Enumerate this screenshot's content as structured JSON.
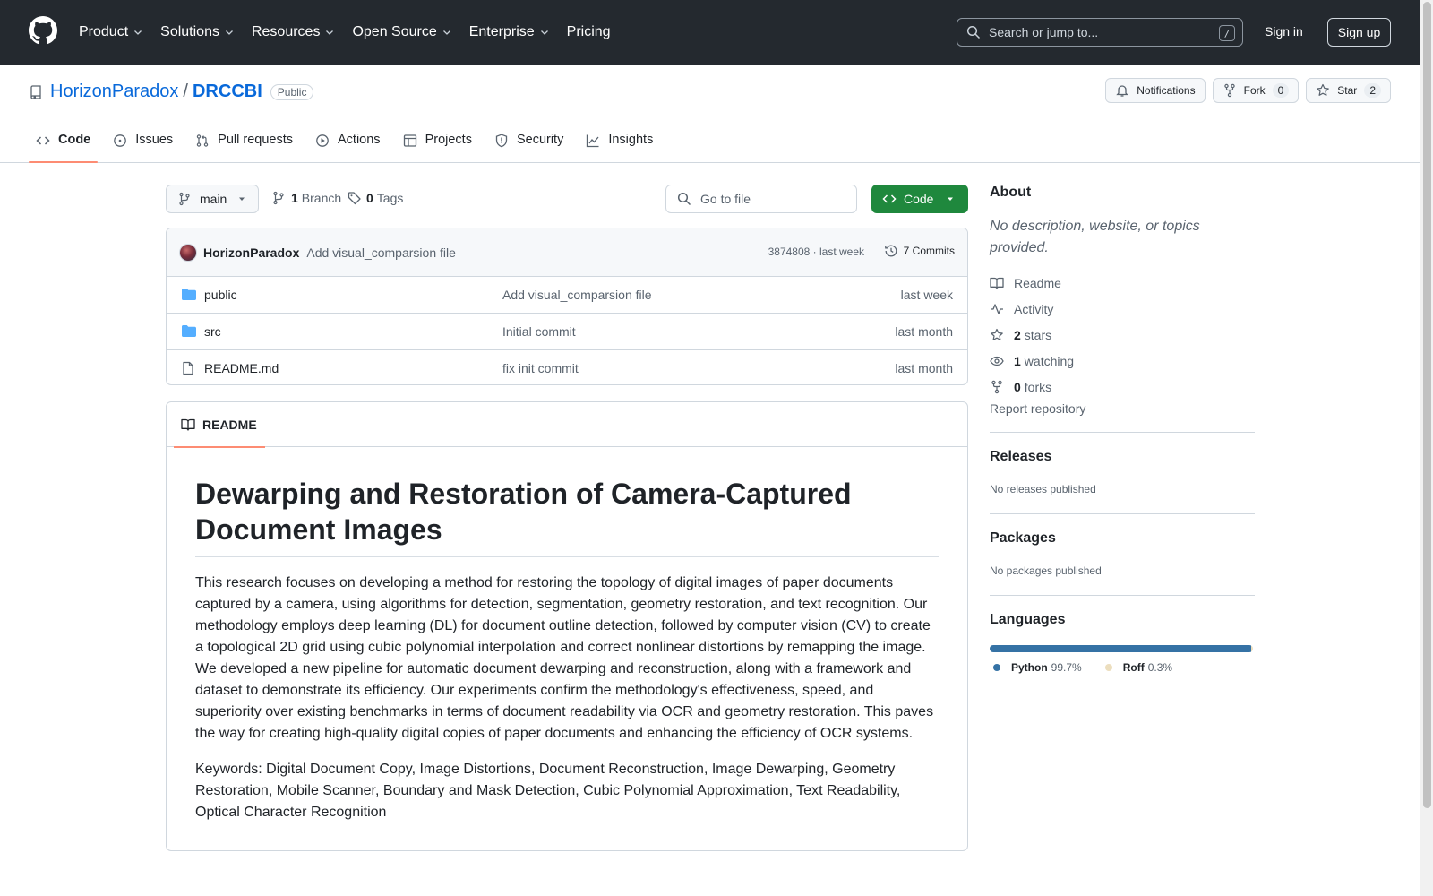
{
  "header": {
    "nav": [
      {
        "label": "Product",
        "has_menu": true
      },
      {
        "label": "Solutions",
        "has_menu": true
      },
      {
        "label": "Resources",
        "has_menu": true
      },
      {
        "label": "Open Source",
        "has_menu": true
      },
      {
        "label": "Enterprise",
        "has_menu": true
      },
      {
        "label": "Pricing",
        "has_menu": false
      }
    ],
    "search_placeholder": "Search or jump to...",
    "search_shortcut": "/",
    "sign_in": "Sign in",
    "sign_up": "Sign up"
  },
  "repo": {
    "owner": "HorizonParadox",
    "separator": "/",
    "name": "DRCCBI",
    "visibility": "Public",
    "notifications_label": "Notifications",
    "fork_label": "Fork",
    "fork_count": "0",
    "star_label": "Star",
    "star_count": "2"
  },
  "tabs": [
    {
      "label": "Code",
      "icon": "code-icon",
      "active": true
    },
    {
      "label": "Issues",
      "icon": "issue-icon",
      "active": false
    },
    {
      "label": "Pull requests",
      "icon": "pull-request-icon",
      "active": false
    },
    {
      "label": "Actions",
      "icon": "play-icon",
      "active": false
    },
    {
      "label": "Projects",
      "icon": "table-icon",
      "active": false
    },
    {
      "label": "Security",
      "icon": "shield-icon",
      "active": false
    },
    {
      "label": "Insights",
      "icon": "graph-icon",
      "active": false
    }
  ],
  "toolbar": {
    "branch": "main",
    "branch_count": "1",
    "branch_label": "Branch",
    "tag_count": "0",
    "tag_label": "Tags",
    "goto_placeholder": "Go to file",
    "code_button": "Code"
  },
  "latest_commit": {
    "author": "HorizonParadox",
    "message": "Add visual_comparsion file",
    "meta": "3874808 · last week",
    "commits_label": "7 Commits"
  },
  "files": [
    {
      "name": "public",
      "type": "folder",
      "message": "Add visual_comparsion file",
      "date": "last week"
    },
    {
      "name": "src",
      "type": "folder",
      "message": "Initial commit",
      "date": "last month"
    },
    {
      "name": "README.md",
      "type": "file",
      "message": "fix init commit",
      "date": "last month"
    }
  ],
  "readme": {
    "tab_label": "README",
    "title": "Dewarping and Restoration of Camera-Captured Document Images",
    "paragraph": "This research focuses on developing a method for restoring the topology of digital images of paper documents captured by a camera, using algorithms for detection, segmentation, geometry restoration, and text recognition. Our methodology employs deep learning (DL) for document outline detection, followed by computer vision (CV) to create a topological 2D grid using cubic polynomial interpolation and correct nonlinear distortions by remapping the image. We developed a new pipeline for automatic document dewarping and reconstruction, along with a framework and dataset to demonstrate its efficiency. Our experiments confirm the methodology's effectiveness, speed, and superiority over existing benchmarks in terms of document readability via OCR and geometry restoration. This paves the way for creating high-quality digital copies of paper documents and enhancing the efficiency of OCR systems.",
    "keywords": "Keywords: Digital Document Copy, Image Distortions, Document Reconstruction, Image Dewarping, Geometry Restoration, Mobile Scanner, Boundary and Mask Detection, Cubic Polynomial Approximation, Text Readability, Optical Character Recognition"
  },
  "sidebar": {
    "about_title": "About",
    "about_desc": "No description, website, or topics provided.",
    "readme_link": "Readme",
    "activity_link": "Activity",
    "stars_count": "2",
    "stars_label": "stars",
    "watching_count": "1",
    "watching_label": "watching",
    "forks_count": "0",
    "forks_label": "forks",
    "report": "Report repository",
    "releases_title": "Releases",
    "releases_text": "No releases published",
    "packages_title": "Packages",
    "packages_text": "No packages published",
    "languages_title": "Languages",
    "languages": [
      {
        "name": "Python",
        "percent": "99.7%",
        "value": 99.7,
        "color": "#3572A5"
      },
      {
        "name": "Roff",
        "percent": "0.3%",
        "value": 0.3,
        "color": "#ecdebe"
      }
    ]
  },
  "colors": {
    "header_bg": "#24292f",
    "link": "#0969da",
    "primary_button": "#1f883d",
    "active_tab_underline": "#fd8c73"
  }
}
